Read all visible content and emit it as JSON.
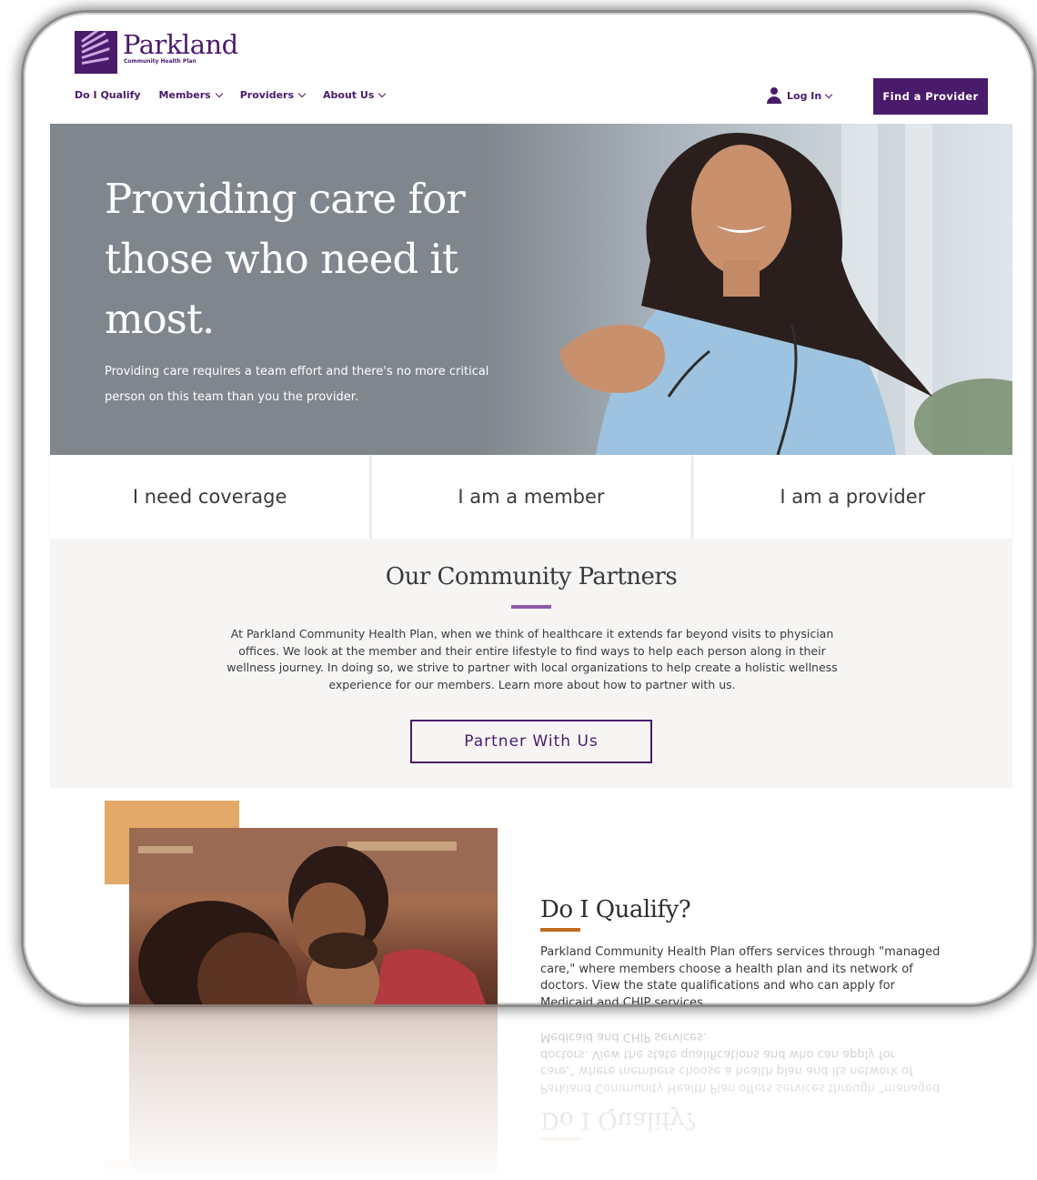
{
  "brand": {
    "name": "Parkland",
    "tagline": "Community Health Plan",
    "purple": "#4a1a6b",
    "accent_orange": "#e2a969"
  },
  "nav": {
    "items": [
      {
        "label": "Do I Qualify",
        "has_dropdown": false
      },
      {
        "label": "Members",
        "has_dropdown": true
      },
      {
        "label": "Providers",
        "has_dropdown": true
      },
      {
        "label": "About Us",
        "has_dropdown": true
      }
    ],
    "login_label": "Log In",
    "find_provider_label": "Find a Provider"
  },
  "hero": {
    "title": "Providing care for those who need it most.",
    "subtitle": "Providing care requires a team effort and there's no more critical person on this team than you the provider."
  },
  "audience": {
    "items": [
      "I need coverage",
      "I am a member",
      "I am a provider"
    ]
  },
  "partners": {
    "heading": "Our Community Partners",
    "body": "At Parkland Community Health Plan, when we think of healthcare it extends far beyond visits to physician offices. We look at the member and their entire lifestyle to find ways to help each person along in their wellness journey. In doing so, we strive to partner with local organizations to help create a holistic wellness experience for our members. Learn more about how to partner with us.",
    "button_label": "Partner With Us"
  },
  "qualify": {
    "heading": "Do I Qualify?",
    "body": "Parkland Community Health Plan offers services through \"managed care,\" where members choose a health plan and its network of doctors. View the state qualifications and who can apply for Medicaid and CHIP services."
  }
}
